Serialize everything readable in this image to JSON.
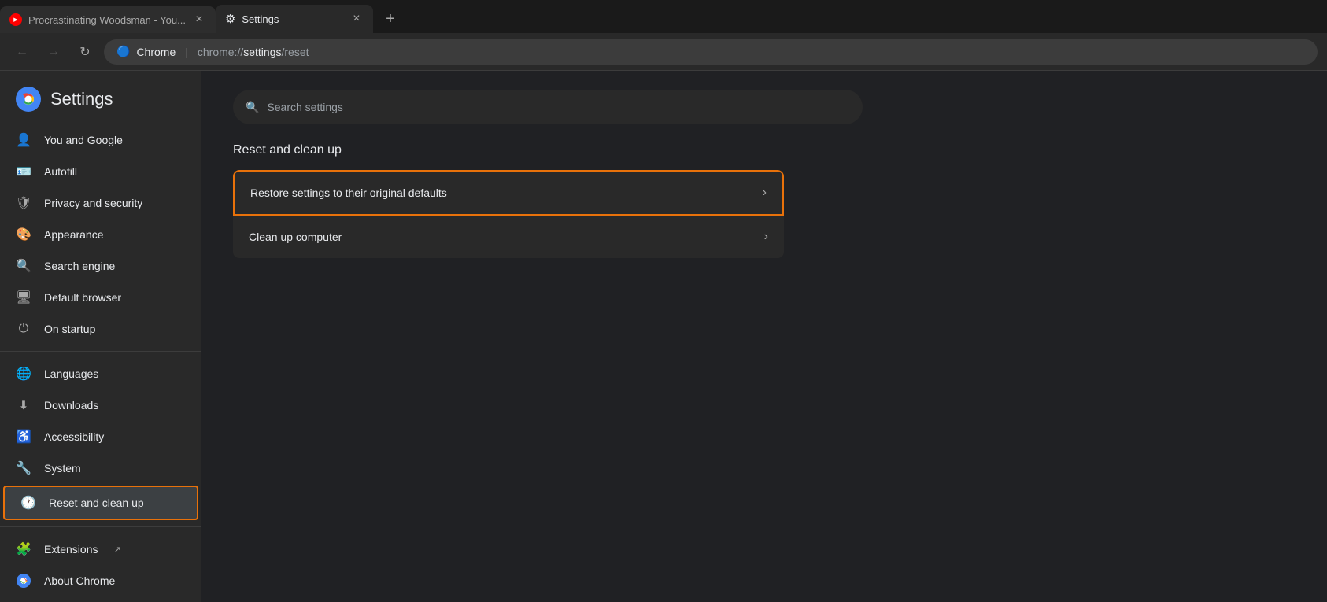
{
  "tabs": [
    {
      "id": "tab-youtube",
      "label": "Procrastinating Woodsman - You...",
      "favicon": "youtube",
      "active": false
    },
    {
      "id": "tab-settings",
      "label": "Settings",
      "favicon": "gear",
      "active": true
    }
  ],
  "addressBar": {
    "back_disabled": true,
    "forward_disabled": true,
    "protocol_icon": "🌐",
    "site_name": "Chrome",
    "separator": "|",
    "url_protocol": "chrome://",
    "url_path": "settings",
    "url_suffix": "/reset"
  },
  "settings_title": "Settings",
  "search": {
    "placeholder": "Search settings"
  },
  "sidebar": {
    "items": [
      {
        "id": "you-and-google",
        "label": "You and Google",
        "icon": "person"
      },
      {
        "id": "autofill",
        "label": "Autofill",
        "icon": "card"
      },
      {
        "id": "privacy-and-security",
        "label": "Privacy and security",
        "icon": "shield"
      },
      {
        "id": "appearance",
        "label": "Appearance",
        "icon": "palette"
      },
      {
        "id": "search-engine",
        "label": "Search engine",
        "icon": "search"
      },
      {
        "id": "default-browser",
        "label": "Default browser",
        "icon": "browser"
      },
      {
        "id": "on-startup",
        "label": "On startup",
        "icon": "power"
      },
      {
        "id": "languages",
        "label": "Languages",
        "icon": "globe"
      },
      {
        "id": "downloads",
        "label": "Downloads",
        "icon": "download"
      },
      {
        "id": "accessibility",
        "label": "Accessibility",
        "icon": "accessibility"
      },
      {
        "id": "system",
        "label": "System",
        "icon": "wrench"
      },
      {
        "id": "reset-and-clean-up",
        "label": "Reset and clean up",
        "icon": "reset",
        "active": true
      },
      {
        "id": "extensions",
        "label": "Extensions",
        "icon": "puzzle",
        "external": true
      },
      {
        "id": "about-chrome",
        "label": "About Chrome",
        "icon": "chrome"
      }
    ]
  },
  "content": {
    "section_title": "Reset and clean up",
    "rows": [
      {
        "id": "restore-defaults",
        "label": "Restore settings to their original defaults",
        "highlighted": true
      },
      {
        "id": "clean-up-computer",
        "label": "Clean up computer",
        "highlighted": false
      }
    ]
  }
}
